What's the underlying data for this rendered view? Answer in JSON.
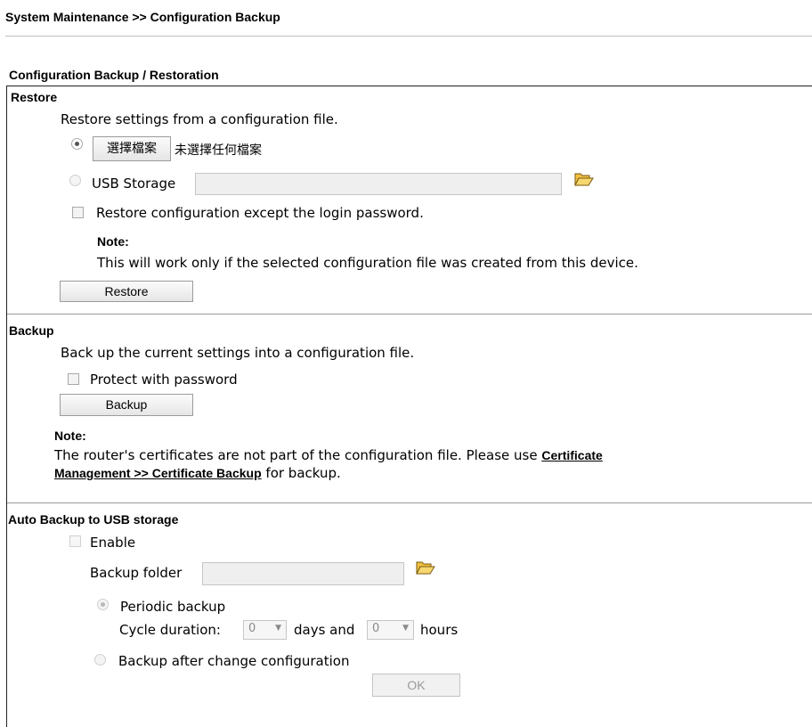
{
  "header": {
    "title": "System Maintenance >> Configuration Backup"
  },
  "section_title": "Configuration Backup / Restoration",
  "restore": {
    "heading": "Restore",
    "description": "Restore settings from a configuration file.",
    "choose_file_button": "選擇檔案",
    "no_file_text": "未選擇任何檔案",
    "usb_storage_label": "USB Storage",
    "usb_storage_value": "",
    "except_login_label": "Restore configuration except the login password.",
    "note_label": "Note:",
    "note_text": "This will work only if the selected configuration file was created from this device.",
    "restore_button": "Restore"
  },
  "backup": {
    "heading": "Backup",
    "description": "Back up the current settings into a configuration file.",
    "protect_label": "Protect with password",
    "backup_button": "Backup",
    "note_label": "Note:",
    "note_line1_prefix": "The router's certificates are not part of the configuration file. Please use ",
    "note_link_part1": "Certificate",
    "note_link_part2": "Management >> Certificate Backup",
    "note_line2_suffix": " for backup."
  },
  "auto_backup": {
    "heading": "Auto Backup to USB storage",
    "enable_label": "Enable",
    "folder_label": "Backup folder",
    "folder_value": "",
    "periodic_label": "Periodic backup",
    "cycle_label": "Cycle duration:",
    "days_value": "0",
    "days_label": "days and",
    "hours_value": "0",
    "hours_label": "hours",
    "after_change_label": "Backup after change configuration",
    "ok_button": "OK"
  },
  "icons": {
    "folder": "folder-open-icon",
    "dropdown": "chevron-down-icon"
  },
  "colors": {
    "border": "#222222",
    "separator": "#9a9a9a",
    "disabled_text": "#9a9a9a",
    "link": "#000000"
  }
}
